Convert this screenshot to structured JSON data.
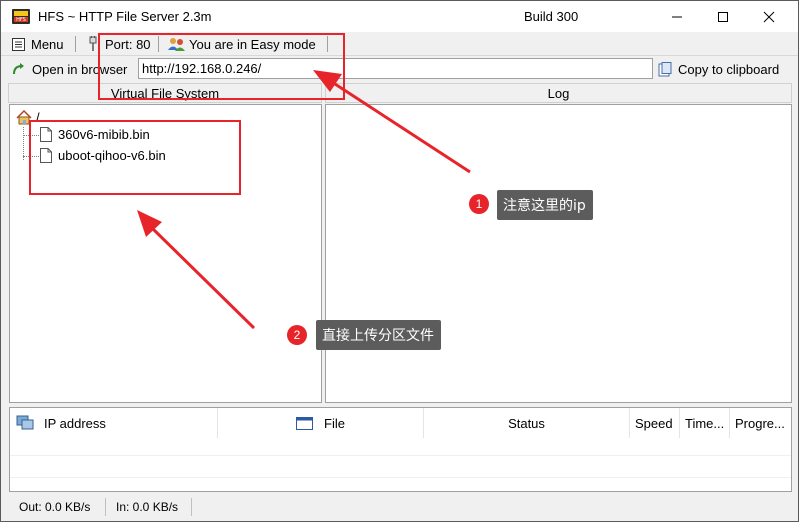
{
  "window": {
    "title": "HFS ~ HTTP File Server 2.3m",
    "build": "Build 300"
  },
  "toolbar": {
    "menu_label": "Menu",
    "port_label": "Port: 80",
    "mode_label": "You are in Easy mode"
  },
  "address_bar": {
    "open_browser_label": "Open in browser",
    "url": "http://192.168.0.246/",
    "copy_label": "Copy to clipboard"
  },
  "panels": {
    "vfs_title": "Virtual File System",
    "log_title": "Log"
  },
  "vfs_tree": {
    "root": "/",
    "files": [
      "360v6-mibib.bin",
      "uboot-qihoo-v6.bin"
    ]
  },
  "connections": {
    "columns": [
      "IP address",
      "File",
      "Status",
      "Speed",
      "Time...",
      "Progre..."
    ]
  },
  "status": {
    "out": "Out: 0.0 KB/s",
    "in": "In: 0.0 KB/s"
  },
  "annotations": [
    {
      "badge": "1",
      "text": "注意这里的ip"
    },
    {
      "badge": "2",
      "text": "直接上传分区文件"
    }
  ],
  "colors": {
    "highlight": "#e8242b",
    "callout_bg": "#5c5c5c"
  }
}
